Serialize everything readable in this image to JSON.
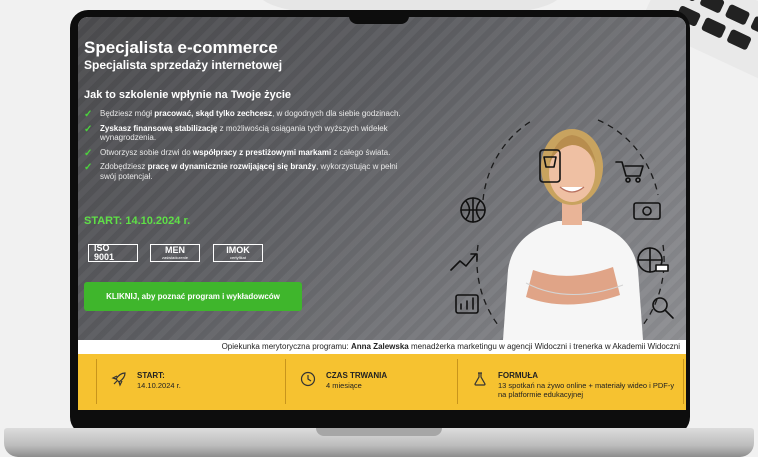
{
  "hero": {
    "title": "Specjalista e-commerce",
    "subtitle": "Specjalista sprzedaży internetowej",
    "section_heading": "Jak to szkolenie wpłynie na Twoje życie",
    "benefits": [
      {
        "pre": "Będziesz mógł ",
        "bold": "pracować, skąd tylko zechcesz",
        "post": ", w dogodnych dla siebie godzinach."
      },
      {
        "pre": "",
        "bold": "Zyskasz finansową stabilizację",
        "post": " z możliwością osiągania tych wyższych widełek wynagrodzenia."
      },
      {
        "pre": "Otworzysz sobie drzwi do ",
        "bold": "współpracy z prestiżowymi markami",
        "post": " z całego świata."
      },
      {
        "pre": "Zdobędziesz ",
        "bold": "pracę w dynamicznie rozwijającej się branży",
        "post": ", wykorzystując w pełni swój potencjał."
      }
    ],
    "start_text": "START: 14.10.2024 r.",
    "badges": [
      {
        "main": "ISO 9001",
        "sub": ""
      },
      {
        "main": "MEN",
        "sub": "zaświadczenie"
      },
      {
        "main": "IMOK",
        "sub": "certyfikat"
      }
    ],
    "cta_label": "KLIKNIJ, aby poznać program i wykładowców"
  },
  "caption": {
    "prefix": "Opiekunka merytoryczna programu: ",
    "name": "Anna Zalewska",
    "suffix": " menadżerka marketingu w agencji Widoczni i trenerka w Akademii Widoczni"
  },
  "info_bar": {
    "start": {
      "label": "START:",
      "value": "14.10.2024 r.",
      "icon": "rocket-icon"
    },
    "duration": {
      "label": "CZAS TRWANIA",
      "value": "4 miesiące",
      "icon": "clock-icon"
    },
    "formula": {
      "label": "FORMUŁA",
      "value": "13 spotkań na żywo online + materiały wideo i PDF-y na platformie edukacyjnej",
      "icon": "flask-icon"
    }
  },
  "colors": {
    "accent_green": "#3fb62c",
    "start_green": "#5fe047",
    "info_yellow": "#f6c230"
  }
}
